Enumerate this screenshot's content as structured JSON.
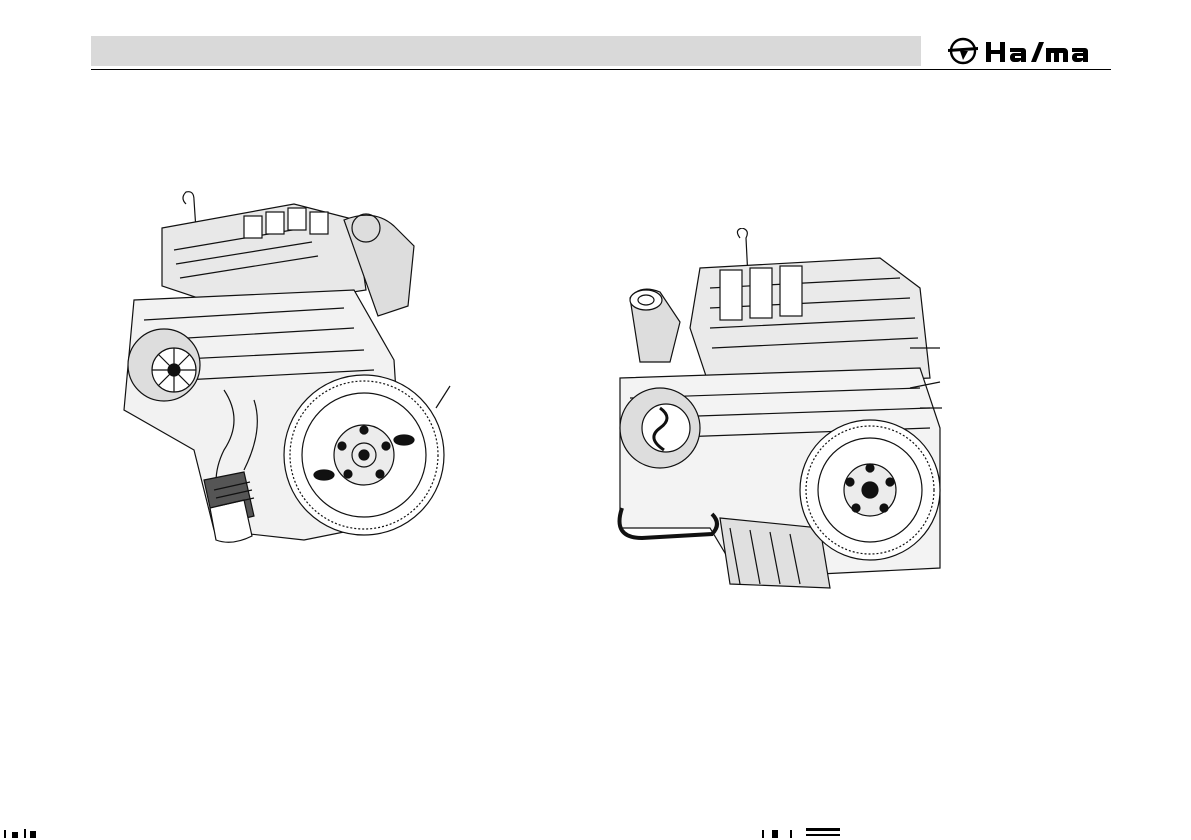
{
  "header": {
    "brand": "Haima",
    "logo_text": "HaIma",
    "bar_color": "#d9d9d9"
  },
  "figures": [
    {
      "icon": "engine-illustration-left"
    },
    {
      "icon": "engine-illustration-right"
    }
  ]
}
